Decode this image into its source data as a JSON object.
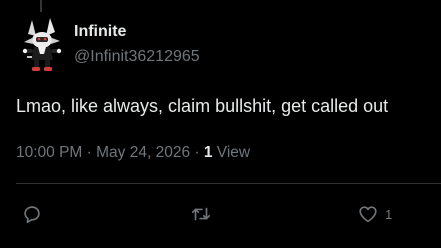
{
  "post": {
    "author": {
      "display_name": "Infinite",
      "handle": "@Infinit36212965",
      "avatar_icon": "fox-character-avatar"
    },
    "text": "Lmao, like always, claim bullshit, get called out",
    "timestamp": {
      "time": "10:00 PM",
      "separator_1": " · ",
      "date": "May 24, 2026",
      "separator_2": " · "
    },
    "views": {
      "count": "1",
      "label": " View"
    },
    "actions": {
      "reply": {
        "icon": "reply-icon",
        "count": ""
      },
      "retweet": {
        "icon": "retweet-icon",
        "count": ""
      },
      "like": {
        "icon": "heart-icon",
        "count": "1"
      }
    }
  },
  "colors": {
    "background": "#000000",
    "text_primary": "#e7e9ea",
    "text_secondary": "#71767b",
    "divider": "#2f3336"
  }
}
